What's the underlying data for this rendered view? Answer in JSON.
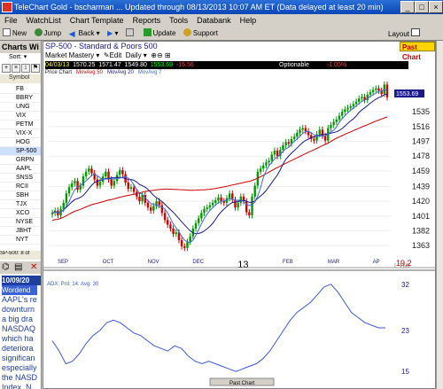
{
  "window": {
    "title": "TeleChart Gold - bscharman ... Updated through 08/13/2013  10:07 AM ET  (Data delayed at least 20 min)",
    "controls": [
      "_",
      "□",
      "×"
    ]
  },
  "menu": [
    "File",
    "WatchList",
    "Chart Template",
    "Reports",
    "Tools",
    "Databank",
    "Help"
  ],
  "toolbar": {
    "new": "New",
    "jump": "Jump",
    "back": "Back",
    "update": "Update",
    "support": "Support",
    "layout": "Layout"
  },
  "left_panel": {
    "header": "Charts Wi",
    "sort_label": "Sort:",
    "symbol_col": "Symbol",
    "symbols": [
      "FB",
      "BBRY",
      "UNG",
      "VIX",
      "PETM",
      "VIX-X",
      "HOG",
      "SP-500",
      "GRPN",
      "AAPL",
      "SNSS",
      "RCII",
      "SBH",
      "TJX",
      "XCO",
      "NYSE",
      "JBHT",
      "NYT"
    ],
    "selected_symbol": "SP-500",
    "status": "SP-500: 8 of",
    "news_date": "10/09/20",
    "news_headline": "Wordend",
    "news_body": "AAPL's re\ndownturn\na big dra\nNASDAQ\nwhich ha\ndeteriora\nsignifican\nespecially\nthe NASD\nIndex. N\nS00 is ..."
  },
  "chart": {
    "title": "SP-500 - Standard & Poors 500",
    "past_chart_label": "Past Chart",
    "market_mastery": "Market Mastery",
    "edit": "Edit",
    "period": "Daily",
    "quote": {
      "date": "04/03/13",
      "open": "1570.25",
      "high": "1571.47",
      "low": "1549.80",
      "close": "1553.69",
      "change": "-16.56",
      "optionable": "Optionable",
      "pct_change": "-1.05%"
    },
    "legend": {
      "price": "Price Chart",
      "ma50": "MovAvg 50",
      "ma20": "MovAvg 20",
      "ma7": "MovAvg 7"
    },
    "last_price_label": "1553.69",
    "right_volume_label": "19.2",
    "right_volume_suffix": "L TML",
    "lower_label": "ADX: Prd: 14: Avg: 30",
    "lower_scroll_label": "Past Chart",
    "colors": {
      "up": "#009900",
      "down": "#cc0000",
      "ma50": "#cc0000",
      "ma20": "#1a1a8a",
      "ma7": "#3a6ad6",
      "adx": "#3a5ad6"
    }
  },
  "chart_data": [
    {
      "type": "candlestick",
      "title": "SP-500 - Standard & Poors 500",
      "x_ticks": [
        "SEP",
        "OCT",
        "NOV",
        "DEC",
        "13",
        "FEB",
        "MAR",
        "AP"
      ],
      "y_ticks": [
        1535,
        1516,
        1497,
        1478,
        1459,
        1439,
        1420,
        1401,
        1382,
        1363
      ],
      "ylim": [
        1345,
        1575
      ],
      "close_series": [
        1405,
        1408,
        1402,
        1410,
        1418,
        1430,
        1438,
        1443,
        1446,
        1435,
        1440,
        1452,
        1458,
        1462,
        1456,
        1448,
        1440,
        1445,
        1452,
        1458,
        1448,
        1440,
        1446,
        1454,
        1460,
        1455,
        1444,
        1436,
        1438,
        1432,
        1426,
        1420,
        1428,
        1418,
        1412,
        1408,
        1414,
        1420,
        1415,
        1405,
        1396,
        1390,
        1385,
        1378,
        1380,
        1370,
        1362,
        1360,
        1368,
        1375,
        1385,
        1392,
        1398,
        1405,
        1410,
        1412,
        1415,
        1418,
        1421,
        1425,
        1420,
        1418,
        1424,
        1430,
        1422,
        1412,
        1418,
        1426,
        1420,
        1406,
        1402,
        1426,
        1440,
        1458,
        1462,
        1466,
        1470,
        1472,
        1480,
        1485,
        1478,
        1486,
        1492,
        1496,
        1494,
        1500,
        1503,
        1508,
        1512,
        1514,
        1510,
        1505,
        1500,
        1498,
        1506,
        1512,
        1504,
        1498,
        1514,
        1518,
        1522,
        1525,
        1530,
        1535,
        1538,
        1540,
        1542,
        1545,
        1548,
        1552,
        1554,
        1550,
        1557,
        1560,
        1563,
        1565,
        1562,
        1558,
        1570,
        1553.69
      ],
      "series": [
        {
          "name": "MovAvg 50",
          "values_start": 1390,
          "values_end": 1525
        },
        {
          "name": "MovAvg 20"
        },
        {
          "name": "MovAvg 7"
        }
      ]
    },
    {
      "type": "line",
      "title": "ADX: Prd: 14: Avg: 30",
      "y_ticks": [
        32,
        23,
        15
      ],
      "ylim": [
        14,
        33
      ],
      "values": [
        21,
        19,
        16.5,
        17,
        18.5,
        20.5,
        22,
        23,
        24.5,
        25,
        24.5,
        23.5,
        22.5,
        22,
        21,
        20,
        19.5,
        19,
        20,
        19.5,
        18,
        17,
        16.5,
        17,
        16.5,
        16,
        15.5,
        15,
        15.5,
        16,
        16.5,
        17.5,
        19,
        21,
        23,
        25,
        26.5,
        27.5,
        28.5,
        30,
        31.5,
        32,
        30.5,
        28.5,
        26.5,
        25.5,
        24.5,
        24,
        23.5,
        23.5
      ]
    }
  ]
}
